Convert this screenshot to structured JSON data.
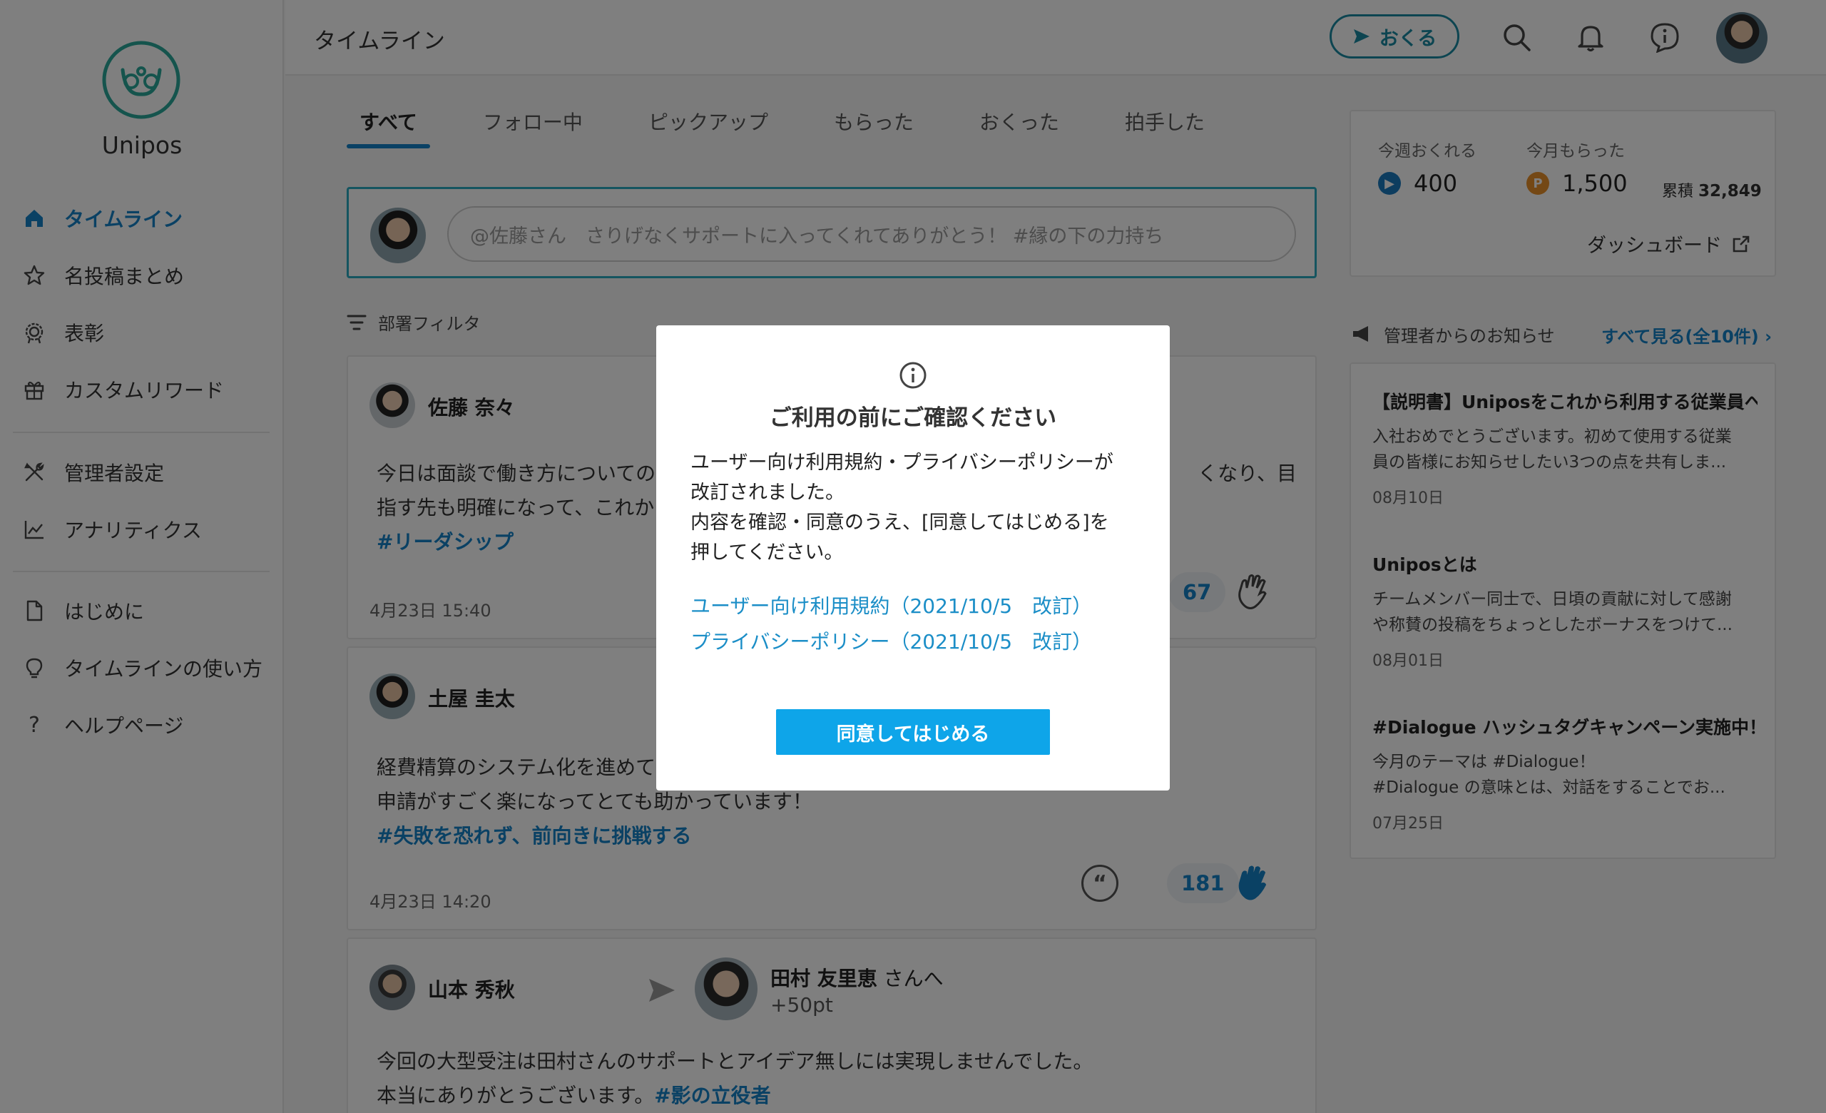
{
  "app": {
    "logo_text": "Unipos"
  },
  "sidebar": {
    "items": [
      {
        "label": "タイムライン",
        "icon": "home-icon",
        "active": true
      },
      {
        "label": "名投稿まとめ",
        "icon": "star-icon"
      },
      {
        "label": "表彰",
        "icon": "award-icon"
      },
      {
        "label": "カスタムリワード",
        "icon": "gift-icon"
      },
      {
        "label": "管理者設定",
        "icon": "tools-icon"
      },
      {
        "label": "アナリティクス",
        "icon": "chart-icon"
      },
      {
        "label": "はじめに",
        "icon": "document-icon"
      },
      {
        "label": "タイムラインの使い方",
        "icon": "lightbulb-icon"
      },
      {
        "label": "ヘルプページ",
        "icon": "help-icon"
      }
    ]
  },
  "header": {
    "title": "タイムライン",
    "send_label": "おくる"
  },
  "tabs": [
    {
      "label": "すべて",
      "active": true
    },
    {
      "label": "フォロー中"
    },
    {
      "label": "ピックアップ"
    },
    {
      "label": "もらった"
    },
    {
      "label": "おくった"
    },
    {
      "label": "拍手した"
    }
  ],
  "compose": {
    "placeholder": "@佐藤さん　さりげなくサポートに入ってくれてありがとう！ #縁の下の力持ち"
  },
  "filter": {
    "label": "部署フィルタ"
  },
  "posts": [
    {
      "sender": "佐藤 奈々",
      "line1": "今日は面談で働き方についての",
      "line1_end": "くなり、目",
      "line2": "指す先も明確になって、これか",
      "tag": "#リーダシップ",
      "date": "4月23日 15:40",
      "claps": "67"
    },
    {
      "sender": "土屋 圭太",
      "line1": "経費精算のシステム化を進めて",
      "line2": "申請がすごく楽になってとても助かっています！",
      "tag": "#失敗を恐れず、前向きに挑戦する",
      "date": "4月23日 14:20",
      "claps": "181"
    },
    {
      "sender": "山本 秀秋",
      "recipient": "田村 友里恵",
      "recipient_suffix": "さんへ",
      "points": "+50pt",
      "line1": "今回の大型受注は田村さんのサポートとアイデア無しには実現しませんでした。",
      "line2": "本当にありがとうございます。",
      "tag": "#影の立役者"
    }
  ],
  "stats": {
    "week_label": "今週おくれる",
    "week_value": "400",
    "month_label": "今月もらった",
    "month_value": "1,500",
    "total_label": "累積",
    "total_value": "32,849",
    "dashboard_label": "ダッシュボード",
    "send_color": "#1b7bbf",
    "point_color": "#e8902a"
  },
  "news": {
    "header": "管理者からのお知らせ",
    "see_all": "すべて見る(全10件)",
    "items": [
      {
        "title": "【説明書】Uniposをこれから利用する従業員へ",
        "body1": "入社おめでとうございます。初めて使用する従業",
        "body2": "員の皆様にお知らせしたい3つの点を共有しま...",
        "date": "08月10日"
      },
      {
        "title": "Uniposとは",
        "body1": "チームメンバー同士で、日頃の貢献に対して感謝",
        "body2": "や称賛の投稿をちょっとしたボーナスをつけて...",
        "date": "08月01日"
      },
      {
        "title": "#Dialogue ハッシュタグキャンペーン実施中！",
        "body1": "今月のテーマは #Dialogue！",
        "body2": "#Dialogue の意味とは、対話をすることでお...",
        "date": "07月25日"
      }
    ]
  },
  "modal": {
    "title": "ご利用の前にご確認ください",
    "text1": "ユーザー向け利用規約・プライバシーポリシーが",
    "text2": "改訂されました。",
    "text3": "内容を確認・同意のうえ、[同意してはじめる]を",
    "text4": "押してください。",
    "link_terms": "ユーザー向け利用規約（2021/10/5　改訂）",
    "link_privacy": "プライバシーポリシー（2021/10/5　改訂）",
    "agree_button": "同意してはじめる"
  },
  "colors": {
    "accent": "#1483c9",
    "brand_teal": "#2aaac0",
    "primary_button": "#0ea5e9"
  }
}
